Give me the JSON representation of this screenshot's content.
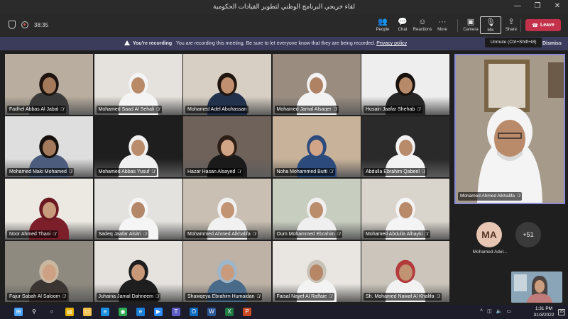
{
  "window": {
    "title": "لقاء خريجي البرنامج الوطني لتطوير القيادات الحكومية"
  },
  "toolbar": {
    "timer": "38:35",
    "buttons": [
      {
        "label": "People",
        "icon": "people-icon",
        "glyph": "👥"
      },
      {
        "label": "Chat",
        "icon": "chat-icon",
        "glyph": "💬"
      },
      {
        "label": "Reactions",
        "icon": "reactions-icon",
        "glyph": "☺"
      },
      {
        "label": "More",
        "icon": "more-icon",
        "glyph": "···"
      },
      {
        "label": "Camera",
        "icon": "camera-icon",
        "glyph": "▣"
      },
      {
        "label": "Mic",
        "icon": "mic-off-icon",
        "glyph": "🎙"
      },
      {
        "label": "Share",
        "icon": "share-icon",
        "glyph": "⇪"
      }
    ],
    "leave_label": "Leave"
  },
  "tooltip": "Unmute (Ctrl+Shift+M)",
  "banner": {
    "heading": "You're recording",
    "message": "You are recording this meeting. Be sure to let everyone know that they are being recorded.",
    "link": "Privacy policy",
    "dismiss": "Dismiss"
  },
  "participants": [
    {
      "name": "Fadhel Abbas Al Jabal",
      "muted": true,
      "wall": "#b8ad9e",
      "skin": "#a57a5a",
      "clothes": "#3a3a3a",
      "hair": "#1d1410"
    },
    {
      "name": "Mohamed Saad Al Sehali",
      "muted": true,
      "wall": "#e5e1dc",
      "skin": "#b98a68",
      "clothes": "#f4f4f4",
      "hair": "#f4f4f4"
    },
    {
      "name": "Mohamed Adel Abuhassan",
      "muted": false,
      "wall": "#d8cfc4",
      "skin": "#c09070",
      "clothes": "#23324c",
      "hair": "#20160f"
    },
    {
      "name": "Mohamed Jamal Alsaqer",
      "muted": true,
      "wall": "#9a8d80",
      "skin": "#b08264",
      "clothes": "#f2f2f2",
      "hair": "#f2f2f2"
    },
    {
      "name": "Husain Jaafar Shehab",
      "muted": true,
      "wall": "#eeeeee",
      "skin": "#b78a6a",
      "clothes": "#262626",
      "hair": "#18110d"
    },
    {
      "name": "Mohamed Maki Mohamed",
      "muted": true,
      "wall": "#dedede",
      "skin": "#a57a5c",
      "clothes": "#4c5c7c",
      "hair": "#17110d"
    },
    {
      "name": "Mohamed Abbas Yusuf",
      "muted": true,
      "wall": "#1e1e1e",
      "skin": "#b98c6c",
      "clothes": "#f0f0f0",
      "hair": "#f0f0f0"
    },
    {
      "name": "Hazar Hasan Alsayed",
      "muted": true,
      "wall": "#6f625a",
      "skin": "#d3a587",
      "clothes": "#1a1a1a",
      "hair": "#2c1d15"
    },
    {
      "name": "Noha Mohammed Butti",
      "muted": true,
      "wall": "#c9b29a",
      "skin": "#d2a589",
      "clothes": "#2c4a7c",
      "hair": "#2c4a7c"
    },
    {
      "name": "Abdulla Ebrahim Qabeel",
      "muted": true,
      "wall": "#2a2a2a",
      "skin": "#b88b6b",
      "clothes": "#f3f3f3",
      "hair": "#f3f3f3"
    },
    {
      "name": "Noor Ahmed Thani",
      "muted": true,
      "wall": "#ece8e2",
      "skin": "#c99b7d",
      "clothes": "#7c1f2a",
      "hair": "#6a1822"
    },
    {
      "name": "Sadeq Jaafar Alsitri",
      "muted": true,
      "wall": "#e4e2de",
      "skin": "#b48768",
      "clothes": "#f5f5f5",
      "hair": "#f5f5f5"
    },
    {
      "name": "Mohammed Ahmed Alkhalifa",
      "muted": true,
      "wall": "#c9bfb2",
      "skin": "#c29474",
      "clothes": "#f1f1f1",
      "hair": "#f1f1f1"
    },
    {
      "name": "Oum Mohammed Ebrahim",
      "muted": true,
      "wall": "#c7cdbf",
      "skin": "#ba8d6c",
      "clothes": "#efefef",
      "hair": "#efefef"
    },
    {
      "name": "Mohamed Abdulla Alhayki",
      "muted": true,
      "wall": "#d9d4cc",
      "skin": "#b98a69",
      "clothes": "#f4f4f4",
      "hair": "#f4f4f4"
    },
    {
      "name": "Fajur Sabah Al Saloom",
      "muted": true,
      "wall": "#8f8a80",
      "skin": "#cfa184",
      "clothes": "#3a3533",
      "hair": "#c9b7a0"
    },
    {
      "name": "Juhaina Jamal Dahneem",
      "muted": true,
      "wall": "#e6e3df",
      "skin": "#c89878",
      "clothes": "#1e1e1e",
      "hair": "#1e1e1e"
    },
    {
      "name": "Shawqeya Ebrahim Humaidan",
      "muted": true,
      "wall": "#bdb2a5",
      "skin": "#c99a7b",
      "clothes": "#4a6a8a",
      "hair": "#9cb6cc"
    },
    {
      "name": "Faisal Nayef Al Raffaie",
      "muted": true,
      "wall": "#e9e6e1",
      "skin": "#b58767",
      "clothes": "#f3f3f3",
      "hair": "#c9c2b8"
    },
    {
      "name": "Sh. Mohamed Nawaf Al Khalifa",
      "muted": true,
      "wall": "#cbc5bc",
      "skin": "#c09373",
      "clothes": "#f2f2f2",
      "hair": "#b23a3a"
    }
  ],
  "spotlight": {
    "name": "Mohamed Ahmed Alkhalifa",
    "wall": "#a69a8b",
    "skin": "#ba8b6b",
    "clothes": "#f4f4f4",
    "hair": "#f4f4f4"
  },
  "roster_avatar": {
    "initials": "MA",
    "name": "Mohamed Adel..."
  },
  "more_participants": "+51",
  "taskbar": {
    "time": "1:31 PM",
    "date": "31/3/2022",
    "notification_count": "20",
    "apps": [
      "start-icon",
      "search-icon",
      "task-view-icon",
      "widgets-icon",
      "file-explorer-icon",
      "edge-icon",
      "chrome-icon",
      "ie-icon",
      "zoom-icon",
      "teams-icon",
      "outlook-icon",
      "word-icon",
      "excel-icon",
      "powerpoint-icon"
    ]
  }
}
